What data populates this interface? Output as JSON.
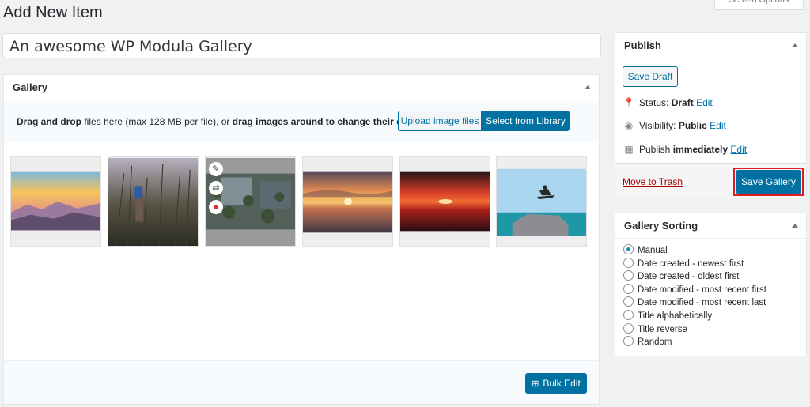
{
  "page": {
    "title": "Add New Item",
    "screen_options": "Screen Options"
  },
  "post_title": {
    "value": "An awesome WP Modula Gallery"
  },
  "gallery": {
    "heading": "Gallery",
    "drop_prefix": "Drag and drop",
    "drop_middle": " files here (max 128 MB per file), or ",
    "drop_bold": "drag images around to change their order",
    "upload_label": "Upload image files",
    "library_label": "Select from Library",
    "bulk_edit_label": "Bulk Edit",
    "images": [
      {
        "name": "mountain-sunrise",
        "palette": [
          "#f7a74f",
          "#d98a86",
          "#7c6f93"
        ]
      },
      {
        "name": "person-phone-grass",
        "palette": [
          "#6e6570",
          "#4b4a3d",
          "#2f3024"
        ]
      },
      {
        "name": "plants-wall",
        "palette": [
          "#5b6b5a",
          "#7a8a8e",
          "#3e4a3a"
        ]
      },
      {
        "name": "ocean-sunset",
        "palette": [
          "#f2a562",
          "#c95b3e",
          "#5b4b52"
        ]
      },
      {
        "name": "red-sunset",
        "palette": [
          "#e9552f",
          "#a71d1b",
          "#3a1418"
        ]
      },
      {
        "name": "skateboard-jump",
        "palette": [
          "#9fd0ea",
          "#1f9aa8",
          "#6e7075"
        ]
      }
    ]
  },
  "publish": {
    "heading": "Publish",
    "save_draft": "Save Draft",
    "status_label": "Status:",
    "status_value": "Draft",
    "visibility_label": "Visibility:",
    "visibility_value": "Public",
    "publish_label": "Publish",
    "publish_value": "immediately",
    "edit_link": "Edit",
    "trash_label": "Move to Trash",
    "save_gallery": "Save Gallery"
  },
  "sorting": {
    "heading": "Gallery Sorting",
    "options": [
      "Manual",
      "Date created - newest first",
      "Date created - oldest first",
      "Date modified - most recent first",
      "Date modified - most recent last",
      "Title alphabetically",
      "Title reverse",
      "Random"
    ],
    "selected": "Manual"
  },
  "colors": {
    "primary": "#0071a1",
    "highlight": "#e01b22",
    "link": "#0073aa",
    "trash": "#aa0000"
  }
}
